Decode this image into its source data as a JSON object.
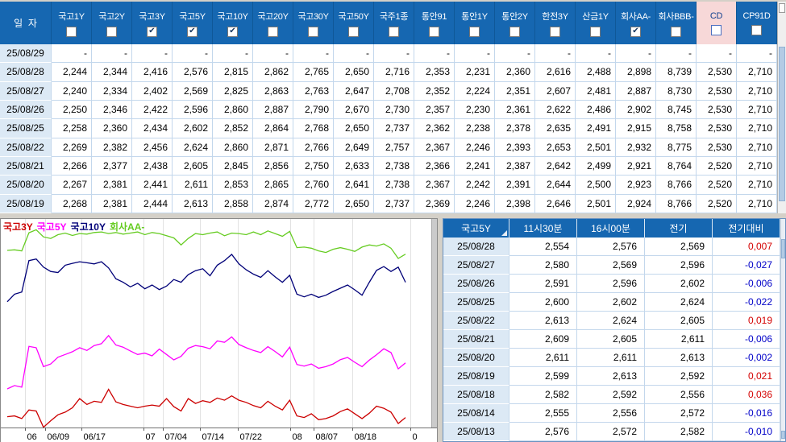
{
  "colors": {
    "window_bg": "#d4d0c8",
    "header_bg": "#1667b1",
    "header_divider": "#0f5898",
    "header_text": "#ffffff",
    "date_col_bg": "#dce9f5",
    "grid_border": "#c3d7ec",
    "cell_bg": "#ffffff",
    "cell_text": "#000000",
    "cd_header_bg": "#f7d8d8",
    "cd_header_text": "#12418f",
    "pos_color": "#d40000",
    "neg_color": "#0000c8",
    "scroll_track": "#efefef",
    "scroll_thumb": "#b3cbe4",
    "panel_border": "#8a8a8a",
    "gridline": "#e2e2e2"
  },
  "top_table": {
    "date_header": "일  자",
    "columns": [
      {
        "label": "국고1Y",
        "checked": false
      },
      {
        "label": "국고2Y",
        "checked": false
      },
      {
        "label": "국고3Y",
        "checked": true
      },
      {
        "label": "국고5Y",
        "checked": true
      },
      {
        "label": "국고10Y",
        "checked": true
      },
      {
        "label": "국고20Y",
        "checked": false
      },
      {
        "label": "국고30Y",
        "checked": false
      },
      {
        "label": "국고50Y",
        "checked": false
      },
      {
        "label": "국주1종",
        "checked": false
      },
      {
        "label": "통안91",
        "checked": false
      },
      {
        "label": "통안1Y",
        "checked": false
      },
      {
        "label": "통안2Y",
        "checked": false
      },
      {
        "label": "한전3Y",
        "checked": false
      },
      {
        "label": "산금1Y",
        "checked": false
      },
      {
        "label": "회사AA-",
        "checked": true
      },
      {
        "label": "회사BBB-",
        "checked": false
      },
      {
        "label": "CD",
        "checked": false,
        "highlight": true
      },
      {
        "label": "CP91D",
        "checked": false
      }
    ],
    "rows": [
      {
        "date": "25/08/29",
        "values": [
          "-",
          "-",
          "-",
          "-",
          "-",
          "-",
          "-",
          "-",
          "-",
          "-",
          "-",
          "-",
          "-",
          "-",
          "-",
          "-",
          "-",
          "-"
        ]
      },
      {
        "date": "25/08/28",
        "values": [
          "2,244",
          "2,344",
          "2,416",
          "2,576",
          "2,815",
          "2,862",
          "2,765",
          "2,650",
          "2,716",
          "2,353",
          "2,231",
          "2,360",
          "2,616",
          "2,488",
          "2,898",
          "8,739",
          "2,530",
          "2,710"
        ]
      },
      {
        "date": "25/08/27",
        "values": [
          "2,240",
          "2,334",
          "2,402",
          "2,569",
          "2,825",
          "2,863",
          "2,763",
          "2,647",
          "2,708",
          "2,352",
          "2,224",
          "2,351",
          "2,607",
          "2,481",
          "2,887",
          "8,730",
          "2,530",
          "2,710"
        ]
      },
      {
        "date": "25/08/26",
        "values": [
          "2,250",
          "2,346",
          "2,422",
          "2,596",
          "2,860",
          "2,887",
          "2,790",
          "2,670",
          "2,730",
          "2,357",
          "2,230",
          "2,361",
          "2,622",
          "2,486",
          "2,902",
          "8,745",
          "2,530",
          "2,710"
        ]
      },
      {
        "date": "25/08/25",
        "values": [
          "2,258",
          "2,360",
          "2,434",
          "2,602",
          "2,852",
          "2,864",
          "2,768",
          "2,650",
          "2,737",
          "2,362",
          "2,238",
          "2,378",
          "2,635",
          "2,491",
          "2,915",
          "8,758",
          "2,530",
          "2,710"
        ]
      },
      {
        "date": "25/08/22",
        "values": [
          "2,269",
          "2,382",
          "2,456",
          "2,624",
          "2,860",
          "2,871",
          "2,766",
          "2,649",
          "2,757",
          "2,367",
          "2,246",
          "2,393",
          "2,653",
          "2,501",
          "2,932",
          "8,775",
          "2,530",
          "2,710"
        ]
      },
      {
        "date": "25/08/21",
        "values": [
          "2,266",
          "2,377",
          "2,438",
          "2,605",
          "2,845",
          "2,856",
          "2,750",
          "2,633",
          "2,738",
          "2,366",
          "2,241",
          "2,387",
          "2,642",
          "2,499",
          "2,921",
          "8,764",
          "2,520",
          "2,710"
        ]
      },
      {
        "date": "25/08/20",
        "values": [
          "2,267",
          "2,381",
          "2,441",
          "2,611",
          "2,853",
          "2,865",
          "2,760",
          "2,641",
          "2,738",
          "2,367",
          "2,242",
          "2,391",
          "2,644",
          "2,500",
          "2,923",
          "8,766",
          "2,520",
          "2,710"
        ]
      },
      {
        "date": "25/08/19",
        "values": [
          "2,268",
          "2,381",
          "2,444",
          "2,613",
          "2,858",
          "2,874",
          "2,772",
          "2,650",
          "2,737",
          "2,369",
          "2,246",
          "2,398",
          "2,646",
          "2,501",
          "2,924",
          "8,766",
          "2,520",
          "2,710"
        ]
      }
    ]
  },
  "bottom_table": {
    "columns": [
      "국고5Y",
      "11시30분",
      "16시00분",
      "전기",
      "전기대비"
    ],
    "rows": [
      [
        "25/08/28",
        "2,554",
        "2,576",
        "2,569",
        "0,007"
      ],
      [
        "25/08/27",
        "2,580",
        "2,569",
        "2,596",
        "-0,027"
      ],
      [
        "25/08/26",
        "2,591",
        "2,596",
        "2,602",
        "-0,006"
      ],
      [
        "25/08/25",
        "2,600",
        "2,602",
        "2,624",
        "-0,022"
      ],
      [
        "25/08/22",
        "2,613",
        "2,624",
        "2,605",
        "0,019"
      ],
      [
        "25/08/21",
        "2,609",
        "2,605",
        "2,611",
        "-0,006"
      ],
      [
        "25/08/20",
        "2,611",
        "2,611",
        "2,613",
        "-0,002"
      ],
      [
        "25/08/19",
        "2,599",
        "2,613",
        "2,592",
        "0,021"
      ],
      [
        "25/08/18",
        "2,582",
        "2,592",
        "2,556",
        "0,036"
      ],
      [
        "25/08/14",
        "2,555",
        "2,556",
        "2,572",
        "-0,016"
      ],
      [
        "25/08/13",
        "2,576",
        "2,572",
        "2,582",
        "-0,010"
      ]
    ]
  },
  "chart_data": {
    "type": "line",
    "ylim": [
      2.245,
      3.01
    ],
    "grid": "vertical",
    "legend_position": "top-left",
    "x_ticks": [
      {
        "text": "06",
        "x": 0.055
      },
      {
        "text": "06/09",
        "x": 0.101
      },
      {
        "text": "06/17",
        "x": 0.184
      },
      {
        "text": "07",
        "x": 0.328
      },
      {
        "text": "07/04",
        "x": 0.372
      },
      {
        "text": "07/14",
        "x": 0.457
      },
      {
        "text": "07/22",
        "x": 0.543
      },
      {
        "text": "08",
        "x": 0.663
      },
      {
        "text": "08/07",
        "x": 0.718
      },
      {
        "text": "08/18",
        "x": 0.805
      },
      {
        "text": "0",
        "x": 0.939
      }
    ],
    "series": [
      {
        "name": "국고3Y",
        "color": "#cc0000",
        "values": [
          2.285,
          2.288,
          2.278,
          2.31,
          2.306,
          2.246,
          2.27,
          2.292,
          2.302,
          2.318,
          2.352,
          2.33,
          2.342,
          2.338,
          2.386,
          2.34,
          2.33,
          2.324,
          2.318,
          2.324,
          2.328,
          2.324,
          2.352,
          2.322,
          2.306,
          2.352,
          2.334,
          2.344,
          2.338,
          2.354,
          2.346,
          2.362,
          2.346,
          2.338,
          2.326,
          2.318,
          2.342,
          2.324,
          2.31,
          2.346,
          2.288,
          2.282,
          2.296,
          2.274,
          2.278,
          2.288,
          2.304,
          2.314,
          2.296,
          2.278,
          2.298,
          2.324,
          2.316,
          2.302,
          2.26,
          2.282
        ]
      },
      {
        "name": "국고5Y",
        "color": "#ff00ff",
        "values": [
          2.388,
          2.4,
          2.394,
          2.545,
          2.54,
          2.47,
          2.48,
          2.505,
          2.515,
          2.525,
          2.54,
          2.53,
          2.548,
          2.555,
          2.585,
          2.55,
          2.542,
          2.528,
          2.515,
          2.52,
          2.51,
          2.535,
          2.515,
          2.495,
          2.508,
          2.538,
          2.548,
          2.544,
          2.536,
          2.565,
          2.56,
          2.58,
          2.552,
          2.54,
          2.53,
          2.522,
          2.544,
          2.526,
          2.506,
          2.542,
          2.478,
          2.472,
          2.48,
          2.464,
          2.47,
          2.48,
          2.496,
          2.504,
          2.486,
          2.47,
          2.494,
          2.514,
          2.536,
          2.522,
          2.462,
          2.484
        ]
      },
      {
        "name": "국고10Y",
        "color": "#000078",
        "values": [
          2.71,
          2.738,
          2.746,
          2.862,
          2.868,
          2.838,
          2.822,
          2.818,
          2.845,
          2.852,
          2.858,
          2.854,
          2.85,
          2.858,
          2.835,
          2.795,
          2.782,
          2.765,
          2.778,
          2.758,
          2.772,
          2.755,
          2.768,
          2.792,
          2.782,
          2.81,
          2.825,
          2.832,
          2.806,
          2.845,
          2.862,
          2.885,
          2.85,
          2.828,
          2.812,
          2.8,
          2.825,
          2.802,
          2.782,
          2.808,
          2.738,
          2.728,
          2.738,
          2.726,
          2.734,
          2.748,
          2.76,
          2.772,
          2.754,
          2.734,
          2.782,
          2.826,
          2.84,
          2.822,
          2.838,
          2.782
        ]
      },
      {
        "name": "회사AA-",
        "color": "#66cc22",
        "values": [
          2.9,
          2.902,
          2.898,
          2.965,
          2.976,
          2.95,
          2.944,
          2.958,
          2.964,
          2.955,
          2.962,
          2.96,
          2.966,
          2.968,
          2.962,
          2.966,
          2.96,
          2.964,
          2.968,
          2.958,
          2.966,
          2.962,
          2.954,
          2.946,
          2.92,
          2.944,
          2.962,
          2.958,
          2.964,
          2.968,
          2.954,
          2.964,
          2.962,
          2.958,
          2.968,
          2.958,
          2.972,
          2.962,
          2.952,
          2.97,
          2.91,
          2.912,
          2.908,
          2.898,
          2.892,
          2.904,
          2.91,
          2.904,
          2.896,
          2.912,
          2.92,
          2.916,
          2.924,
          2.908,
          2.87,
          2.886
        ]
      }
    ]
  }
}
